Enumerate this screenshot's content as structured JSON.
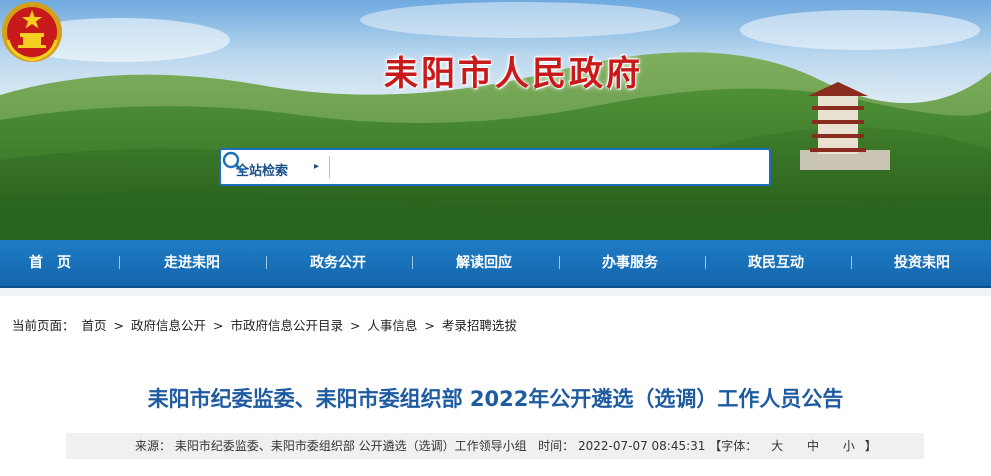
{
  "site": {
    "title": "耒阳市人民政府",
    "emblem_icon": "national-emblem-icon",
    "colors": {
      "title_red": "#c8191b",
      "nav_blue": "#1a72bb",
      "article_title": "#1e5ba0"
    }
  },
  "search": {
    "scope_label": "全站检索",
    "scope_caret": "▸",
    "placeholder": "",
    "value": ""
  },
  "nav": {
    "items": [
      {
        "label": "首　页"
      },
      {
        "label": "走进耒阳"
      },
      {
        "label": "政务公开"
      },
      {
        "label": "解读回应"
      },
      {
        "label": "办事服务"
      },
      {
        "label": "政民互动"
      },
      {
        "label": "投资耒阳"
      }
    ],
    "separator": "ǀ"
  },
  "breadcrumb": {
    "prefix": "当前页面：",
    "items": [
      "首页",
      "政府信息公开",
      "市政府信息公开目录",
      "人事信息",
      "考录招聘选拔"
    ],
    "separator": ">"
  },
  "article": {
    "title": "耒阳市纪委监委、耒阳市委组织部 2022年公开遴选（选调）工作人员公告",
    "source_label": "来源：",
    "source": "耒阳市纪委监委、耒阳市委组织部 公开遴选（选调）工作领导小组",
    "time_label": "时间：",
    "time": "2022-07-07 08:45:31",
    "font_label": "【字体：",
    "font_large": "大",
    "font_medium": "中",
    "font_small": "小",
    "font_close": "】"
  }
}
